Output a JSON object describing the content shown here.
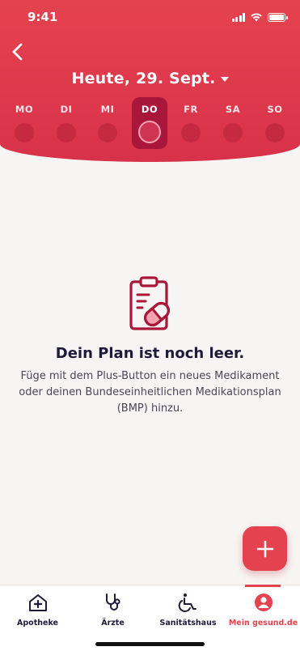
{
  "status_bar": {
    "time": "9:41"
  },
  "header": {
    "date_title": "Heute, 29. Sept.",
    "weekdays": [
      {
        "label": "MO",
        "active": false
      },
      {
        "label": "DI",
        "active": false
      },
      {
        "label": "MI",
        "active": false
      },
      {
        "label": "DO",
        "active": true
      },
      {
        "label": "FR",
        "active": false
      },
      {
        "label": "SA",
        "active": false
      },
      {
        "label": "SO",
        "active": false
      }
    ]
  },
  "empty_state": {
    "title": "Dein Plan ist noch leer.",
    "description": "Füge mit dem Plus-Button ein neues Medikament oder deinen Bundeseinheitlichen Medikationsplan (BMP) hinzu.",
    "icon": "clipboard-pill-icon"
  },
  "fab": {
    "icon": "plus-icon"
  },
  "tabbar": {
    "items": [
      {
        "label": "Apotheke",
        "icon": "pharmacy-icon",
        "active": false
      },
      {
        "label": "Ärzte",
        "icon": "stethoscope-icon",
        "active": false
      },
      {
        "label": "Sanitätshaus",
        "icon": "wheelchair-icon",
        "active": false
      },
      {
        "label": "Mein gesund.de",
        "icon": "profile-icon",
        "active": true
      }
    ]
  },
  "colors": {
    "primary": "#e5424f",
    "active_day": "#a8163a",
    "text_dark": "#1e1b3a"
  }
}
